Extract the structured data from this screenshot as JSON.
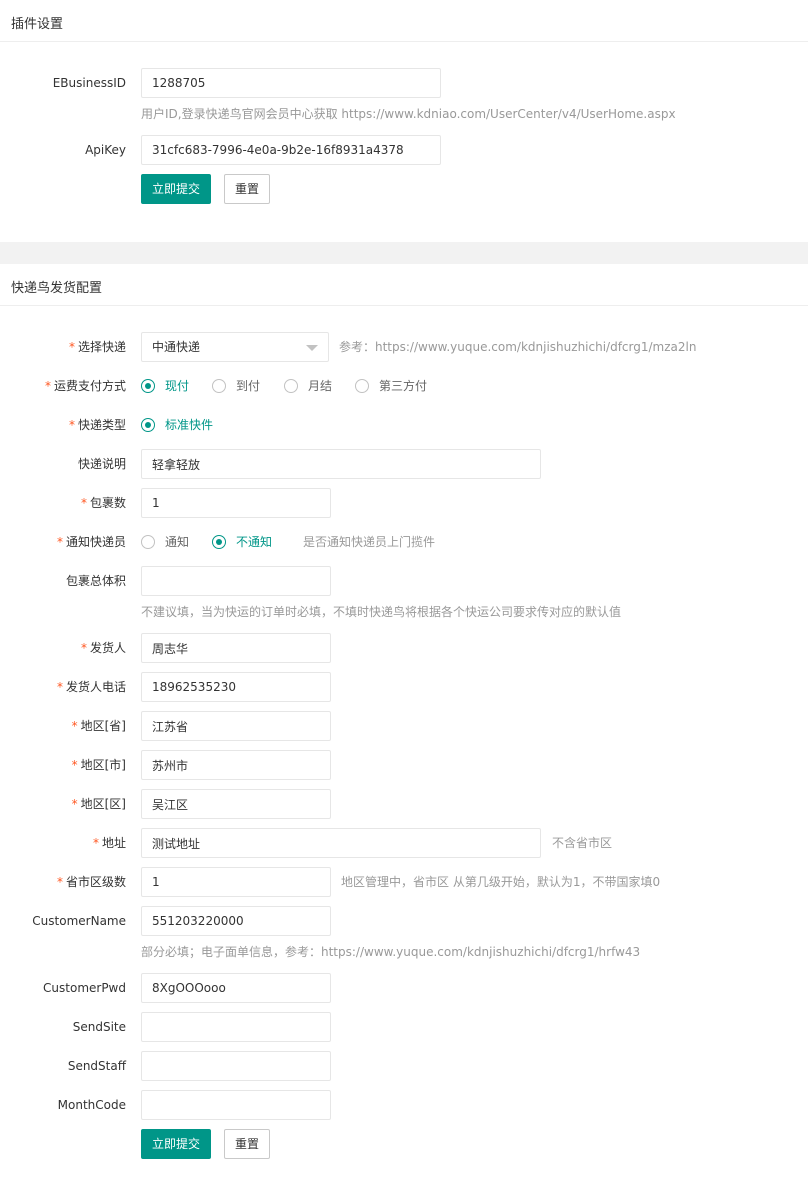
{
  "plugin": {
    "title": "插件设置",
    "ebusiness_label": "EBusinessID",
    "ebusiness_value": "1288705",
    "ebusiness_tip": "用户ID,登录快递鸟官网会员中心获取 https://www.kdniao.com/UserCenter/v4/UserHome.aspx",
    "apikey_label": "ApiKey",
    "apikey_value": "31cfc683-7996-4e0a-9b2e-16f8931a4378",
    "submit_label": "立即提交",
    "reset_label": "重置"
  },
  "ship": {
    "title": "快递鸟发货配置",
    "required_mark": "*",
    "courier_label": "选择快递",
    "courier_value": "中通快递",
    "courier_ref": "参考：https://www.yuque.com/kdnjishuzhichi/dfcrg1/mza2ln",
    "payment_label": "运费支付方式",
    "payment_options": [
      "现付",
      "到付",
      "月结",
      "第三方付"
    ],
    "payment_selected": "现付",
    "type_label": "快递类型",
    "type_options": [
      "标准快件"
    ],
    "desc_label": "快递说明",
    "desc_value": "轻拿轻放",
    "packages_label": "包裹数",
    "packages_value": "1",
    "notify_label": "通知快递员",
    "notify_options": [
      "通知",
      "不通知"
    ],
    "notify_selected": "不通知",
    "notify_tip": "是否通知快递员上门揽件",
    "volume_label": "包裹总体积",
    "volume_value": "",
    "volume_tip": "不建议填，当为快运的订单时必填，不填时快递鸟将根据各个快运公司要求传对应的默认值",
    "sender_label": "发货人",
    "sender_value": "周志华",
    "phone_label": "发货人电话",
    "phone_value": "18962535230",
    "province_label": "地区[省]",
    "province_value": "江苏省",
    "city_label": "地区[市]",
    "city_value": "苏州市",
    "district_label": "地区[区]",
    "district_value": "吴江区",
    "address_label": "地址",
    "address_value": "测试地址",
    "address_tip": "不含省市区",
    "level_label": "省市区级数",
    "level_value": "1",
    "level_tip": "地区管理中，省市区 从第几级开始，默认为1，不带国家填0",
    "customer_name_label": "CustomerName",
    "customer_name_value": "551203220000",
    "customer_name_tip": "部分必填；电子面单信息，参考：https://www.yuque.com/kdnjishuzhichi/dfcrg1/hrfw43",
    "customer_pwd_label": "CustomerPwd",
    "customer_pwd_value": "8XgOOOooo",
    "send_site_label": "SendSite",
    "send_site_value": "",
    "send_staff_label": "SendStaff",
    "send_staff_value": "",
    "month_code_label": "MonthCode",
    "month_code_value": "",
    "submit_label": "立即提交",
    "reset_label": "重置"
  },
  "colors": {
    "primary": "#009688",
    "required": "#FF5722",
    "tip": "#999999",
    "gap": "#f2f2f2"
  }
}
